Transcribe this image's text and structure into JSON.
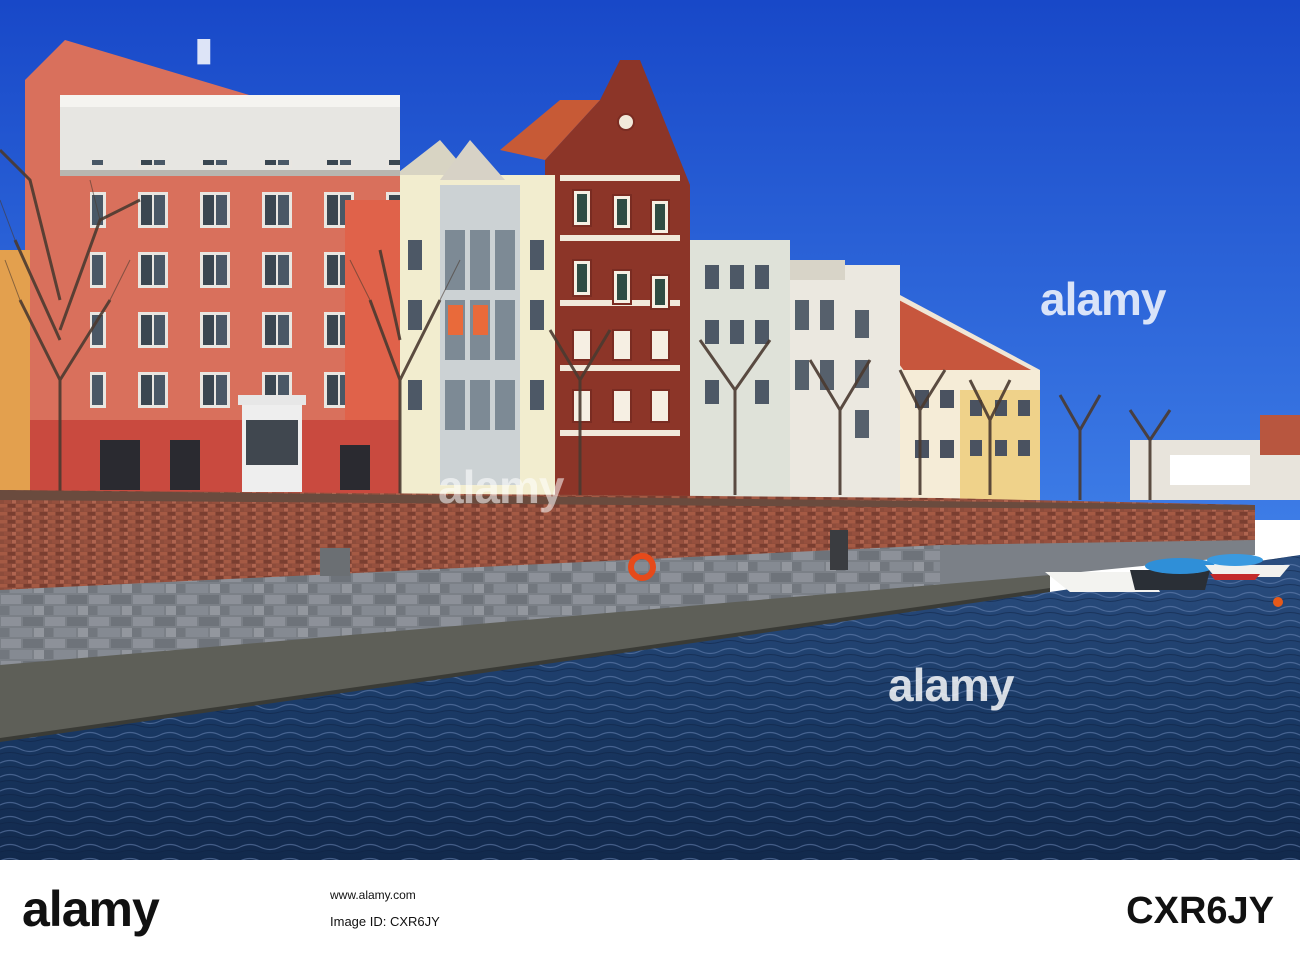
{
  "scene": {
    "colors": {
      "sky": "#1f5cd6",
      "water": "#1a3a66",
      "brick_wall": "#8a4a3a",
      "stone_base": "#7a7f86",
      "red_building": "#d9705c",
      "cream_building": "#f2edcf",
      "brick_gable": "#8c3528"
    }
  },
  "watermarks": {
    "text": "alamy"
  },
  "footer": {
    "logo": "alamy",
    "stock_photo_line": "Image ID: CXR6JY",
    "url": "www.alamy.com",
    "code": "CXR6JY"
  }
}
